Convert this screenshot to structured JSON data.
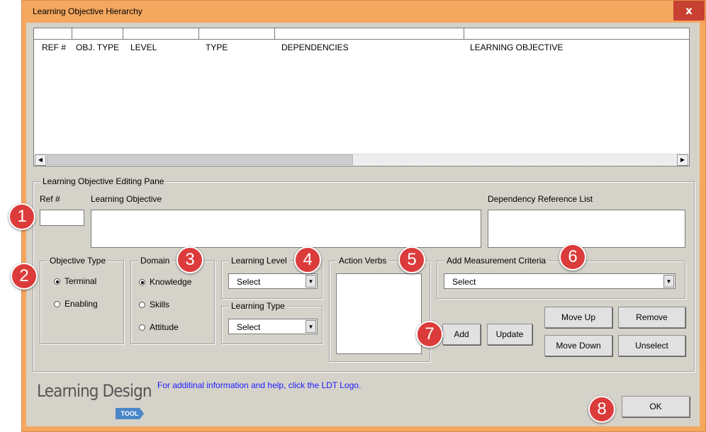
{
  "window": {
    "title": "Learning Objective Hierarchy",
    "close_glyph": "x"
  },
  "list": {
    "columns": [
      "REF #",
      "OBJ. TYPE",
      "LEVEL",
      "TYPE",
      "DEPENDENCIES",
      "LEARNING OBJECTIVE"
    ]
  },
  "pane": {
    "title": "Learning Objective Editing Pane",
    "ref_label": "Ref #",
    "objective_label": "Learning Objective",
    "dependency_label": "Dependency Reference List"
  },
  "objective_type": {
    "title": "Objective Type",
    "options": [
      "Terminal",
      "Enabling"
    ],
    "selected": "Terminal"
  },
  "domain": {
    "title": "Domain",
    "options": [
      "Knowledge",
      "Skills",
      "Attitude"
    ],
    "selected": "Knowledge"
  },
  "learning_level": {
    "title": "Learning Level",
    "value": "Select"
  },
  "learning_type": {
    "title": "Learning Type",
    "value": "Select"
  },
  "action_verbs": {
    "title": "Action Verbs"
  },
  "measurement": {
    "title": "Add Measurement Criteria",
    "value": "Select"
  },
  "buttons": {
    "add": "Add",
    "update": "Update",
    "move_up": "Move Up",
    "remove": "Remove",
    "move_down": "Move Down",
    "unselect": "Unselect",
    "ok": "OK"
  },
  "footer": {
    "logo": "Learning Design",
    "logo_tag": "TOOL",
    "help": "For additinal information and help, click the LDT Logo."
  },
  "badges": [
    "1",
    "2",
    "3",
    "4",
    "5",
    "6",
    "7",
    "8"
  ],
  "colors": {
    "window_frame": "#f4a75f",
    "client": "#d5d2ca",
    "badge": "#dc3b3b",
    "close": "#c84031",
    "help_link": "#1a1aff"
  }
}
